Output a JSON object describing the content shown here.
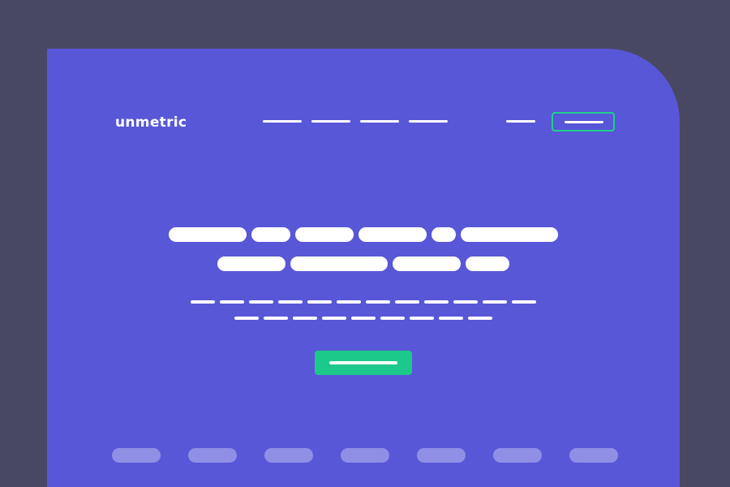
{
  "header": {
    "logo_text": "unmetric",
    "nav_items": [
      "nav-link-1",
      "nav-link-2",
      "nav-link-3",
      "nav-link-4"
    ]
  },
  "hero": {
    "title_line1_words": 6,
    "title_line2_words": 4
  },
  "colors": {
    "background": "#484862",
    "panel": "#5757d7",
    "accent": "#1dc98a",
    "logo_placeholder": "#8f8fe6"
  }
}
